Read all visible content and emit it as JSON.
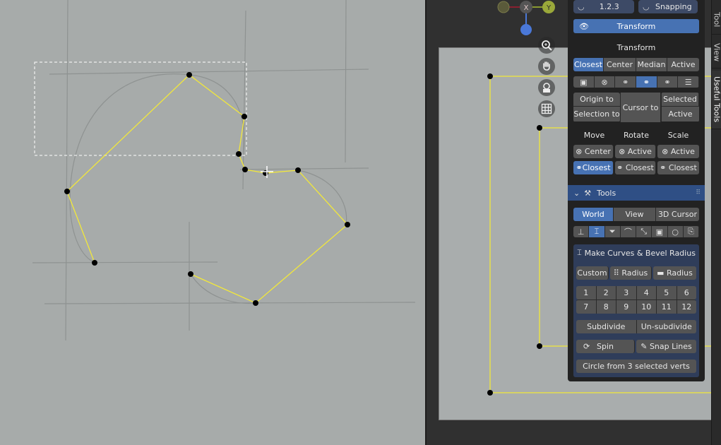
{
  "gizmo": {
    "x_label": "X",
    "y_label": "Y"
  },
  "nav_icons": [
    "zoom-icon",
    "hand-icon",
    "camera-icon",
    "grid-icon"
  ],
  "sidebar_tabs": [
    {
      "label": "Tool",
      "active": false
    },
    {
      "label": "View",
      "active": false
    },
    {
      "label": "Useful Tools",
      "active": true
    }
  ],
  "panel": {
    "header": {
      "version_label": "1.2.3",
      "snapping_label": "Snapping"
    },
    "transform_button": "Transform",
    "transform_title": "Transform",
    "pivot_options": [
      "Closest",
      "Center",
      "Median",
      "Active"
    ],
    "pivot_selected": "Closest",
    "origin_to": "Origin to",
    "selection_to": "Selection to",
    "cursor_to": "Cursor to",
    "selected": "Selected",
    "active": "Active",
    "move_label": "Move",
    "rotate_label": "Rotate",
    "scale_label": "Scale",
    "move_center": "Center",
    "rotate_active": "Active",
    "scale_active": "Active",
    "move_closest": "Closest",
    "rotate_closest": "Closest",
    "scale_closest": "Closest",
    "tools_title": "Tools",
    "orientation_options": [
      "World",
      "View",
      "3D Cursor"
    ],
    "orientation_selected": "World",
    "make_curves_label": "Make Curves & Bevel Radius",
    "custom_label": "Custom",
    "radius_label_1": "Radius",
    "radius_label_2": "Radius",
    "number_row_1": [
      "1",
      "2",
      "3",
      "4",
      "5",
      "6"
    ],
    "number_row_2": [
      "7",
      "8",
      "9",
      "10",
      "11",
      "12"
    ],
    "subdivide_label": "Subdivide",
    "unsubdivide_label": "Un-subdivide",
    "spin_label": "Spin",
    "snap_lines_label": "Snap Lines",
    "circle_label": "Circle from 3 selected verts"
  },
  "colors": {
    "accent": "#4772b3",
    "edge": "#f2e83a",
    "vertex": "#000000"
  }
}
